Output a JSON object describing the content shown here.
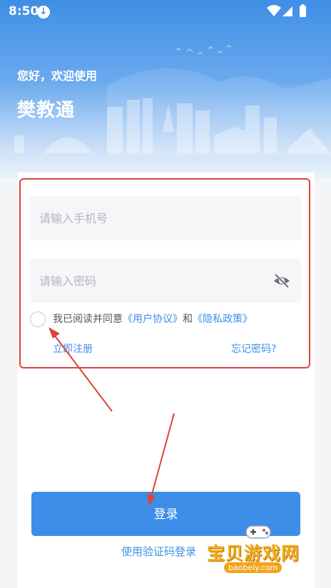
{
  "status_bar": {
    "time": "8:50",
    "download_icon": "download-icon",
    "wifi_icon": "wifi-icon",
    "signal_icon": "signal-icon",
    "battery_icon": "battery-charging-icon"
  },
  "header": {
    "greeting": "您好，欢迎使用",
    "app_name": "樊教通"
  },
  "form": {
    "phone_placeholder": "请输入手机号",
    "password_placeholder": "请输入密码",
    "password_toggle_icon": "eye-hidden-icon",
    "agreement_prefix": "我已阅读并同意",
    "user_agreement": "《用户协议》",
    "and_text": "和",
    "privacy_policy": "《隐私政策》",
    "register_link": "立即注册",
    "forgot_link": "忘记密码?"
  },
  "login_button": "登录",
  "sms_login": "使用验证码登录",
  "annotation": {
    "color": "#d9443a"
  },
  "watermark": {
    "text": "宝贝游戏网",
    "url": "baobeiy.com"
  },
  "colors": {
    "accent": "#3e8de9",
    "hero_top": "#3f8ee6"
  }
}
